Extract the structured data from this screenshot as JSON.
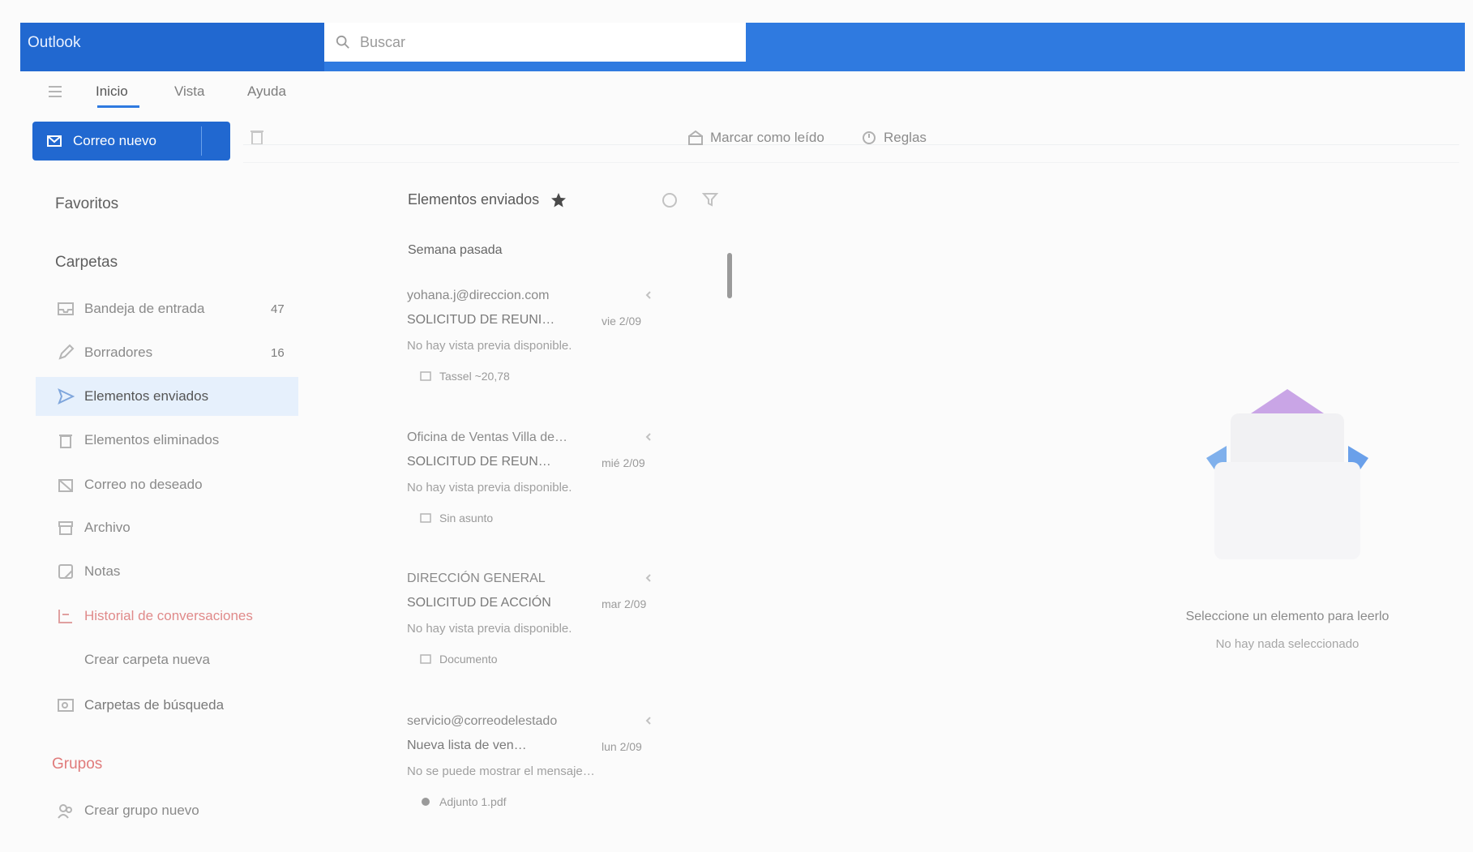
{
  "colors": {
    "brand_blue": "#2f7ae0",
    "brand_blue_dark": "#2168d0",
    "selected_bg": "#e6f0fc",
    "alert_red": "#e07b7b"
  },
  "header": {
    "app_title": "Outlook",
    "search_placeholder": "Buscar",
    "search_icon": "search-icon"
  },
  "ribbon": {
    "tabs": [
      {
        "label": "Inicio",
        "active": true
      },
      {
        "label": "Vista"
      },
      {
        "label": "Ayuda"
      }
    ],
    "new_mail_label": "Correo nuevo",
    "actions": [
      {
        "label": "Marcar como leído",
        "icon": "envelope-open-icon"
      },
      {
        "label": "Reglas",
        "icon": "rules-icon"
      }
    ]
  },
  "folder_pane": {
    "favorites_title": "Favoritos",
    "folders_title": "Carpetas",
    "folders": [
      {
        "label": "Bandeja de entrada",
        "count": "47",
        "icon": "inbox-icon"
      },
      {
        "label": "Borradores",
        "count": "16",
        "icon": "draft-icon"
      },
      {
        "label": "Elementos enviados",
        "count": "",
        "icon": "send-icon",
        "selected": true
      },
      {
        "label": "Elementos eliminados",
        "count": "",
        "icon": "trash-icon"
      },
      {
        "label": "Correo no deseado",
        "count": "",
        "icon": "junk-icon"
      },
      {
        "label": "Archivo",
        "count": "",
        "icon": "archive-icon"
      },
      {
        "label": "Notas",
        "count": "",
        "icon": "note-icon"
      },
      {
        "label": "Historial de conversaciones",
        "count": "",
        "icon": "history-icon"
      },
      {
        "label": "Crear carpeta nueva",
        "count": "",
        "icon": ""
      },
      {
        "label": "Carpetas de búsqueda",
        "count": "",
        "icon": "search-folder-icon"
      }
    ],
    "groups_title": "Grupos",
    "groups": [
      {
        "label": "Crear grupo nuevo",
        "icon": "group-icon"
      }
    ]
  },
  "message_list": {
    "title": "Elementos enviados",
    "group_header": "Semana pasada",
    "messages": [
      {
        "sender": "yohana.j@direccion.com",
        "subject": "SOLICITUD DE REUNI…",
        "date": "vie 2/09",
        "preview": "No hay vista previa disponible.",
        "attachment": "Tassel ~20,78"
      },
      {
        "sender": "Oficina de Ventas Villa de…",
        "subject": "SOLICITUD DE REUN…",
        "date": "mié 2/09",
        "preview": "No hay vista previa disponible.",
        "attachment": "Sin asunto"
      },
      {
        "sender": "DIRECCIÓN GENERAL",
        "subject": "SOLICITUD DE ACCIÓN",
        "date": "mar 2/09",
        "preview": "No hay vista previa disponible.",
        "attachment": "Documento"
      },
      {
        "sender": "servicio@correodelestado",
        "subject": "Nueva lista de ven…",
        "date": "lun 2/09",
        "preview": "No se puede mostrar el mensaje…",
        "attachment": "Adjunto 1.pdf"
      }
    ]
  },
  "reading_pane": {
    "empty_title": "Seleccione un elemento para leerlo",
    "empty_subtitle": "No hay nada seleccionado"
  }
}
